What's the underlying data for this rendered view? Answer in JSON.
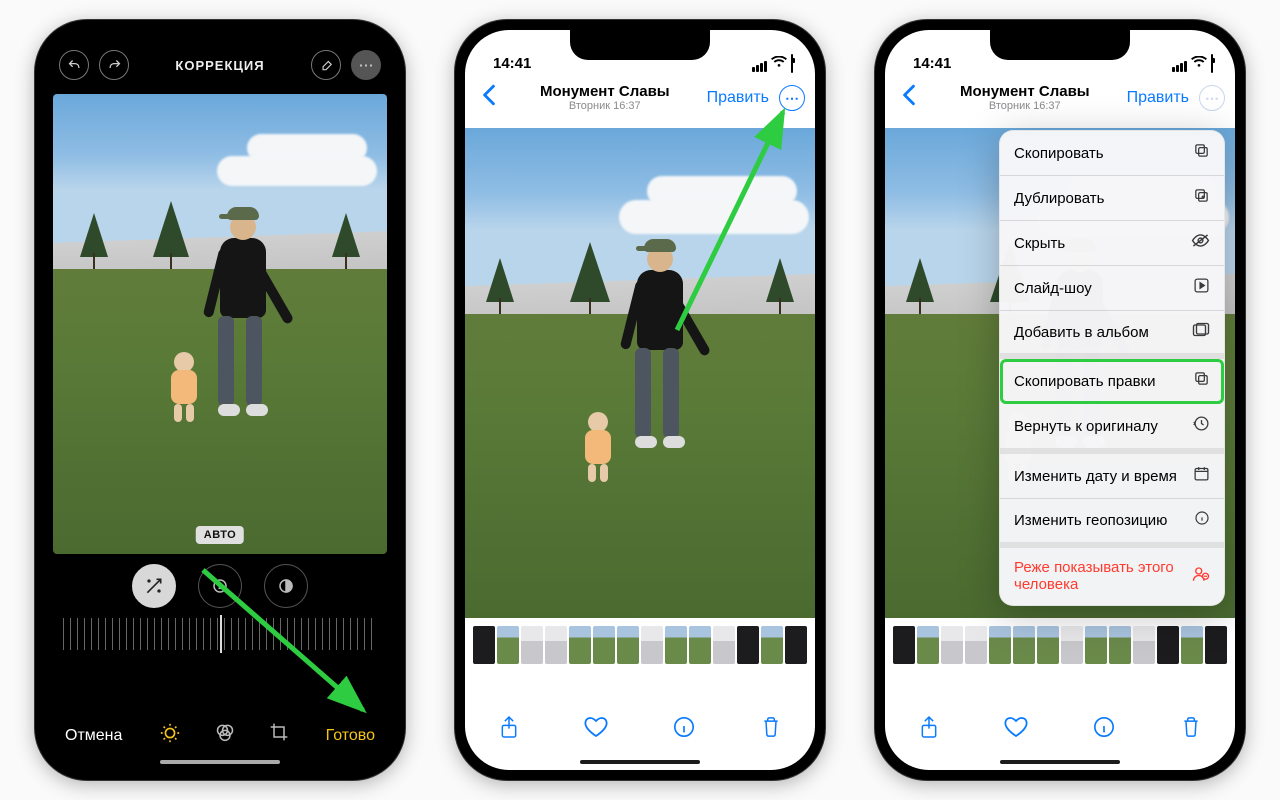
{
  "phone1": {
    "title": "КОРРЕКЦИЯ",
    "autoBadge": "АВТО",
    "cancel": "Отмена",
    "done": "Готово"
  },
  "phone2": {
    "time": "14:41",
    "location": "Монумент Славы",
    "subtitle": "Вторник  16:37",
    "edit": "Править"
  },
  "phone3": {
    "time": "14:41",
    "location": "Монумент Славы",
    "subtitle": "Вторник  16:37",
    "edit": "Править",
    "menu": {
      "copy": "Скопировать",
      "duplicate": "Дублировать",
      "hide": "Скрыть",
      "slideshow": "Слайд-шоу",
      "addToAlbum": "Добавить в альбом",
      "copyEdits": "Скопировать правки",
      "revert": "Вернуть к оригиналу",
      "adjustDate": "Изменить дату и время",
      "adjustLocation": "Изменить геопозицию",
      "featureLess": "Реже показывать этого человека"
    }
  },
  "colors": {
    "iosBlue": "#0a7aff",
    "doneYellow": "#f5c518",
    "highlightGreen": "#2ecc40",
    "destructiveRed": "#ff3b30"
  }
}
